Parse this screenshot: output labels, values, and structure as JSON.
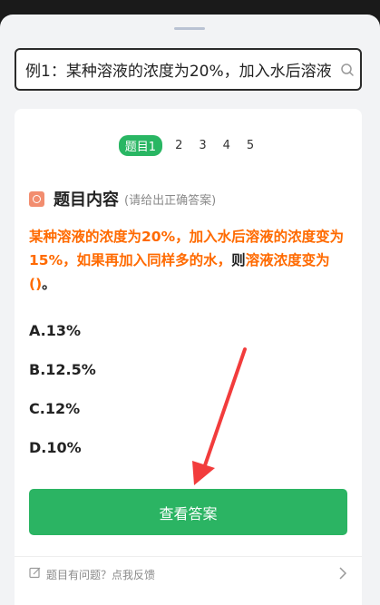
{
  "search": {
    "query": "例1：某种溶液的浓度为20%，加入水后溶液"
  },
  "tabs": [
    {
      "label": "题目1",
      "active": true
    },
    {
      "label": "2"
    },
    {
      "label": "3"
    },
    {
      "label": "4"
    },
    {
      "label": "5"
    }
  ],
  "section": {
    "title": "题目内容",
    "hint": "(请给出正确答案)"
  },
  "question": {
    "part1": "某种溶液的浓度为20%，加入水后溶液的浓度变为15%，如果再加入同样多的水，",
    "part2": "则",
    "part3": "溶液浓度变为()",
    "part4": "。"
  },
  "options": [
    "A.13%",
    "B.12.5%",
    "C.12%",
    "D.10%"
  ],
  "actions": {
    "view_answer": "查看答案"
  },
  "feedback": {
    "label": "题目有问题？点我反馈"
  },
  "colors": {
    "accent_green": "#2bb463",
    "question_orange": "#ff6a00",
    "annotation_red": "#f23c3c"
  }
}
